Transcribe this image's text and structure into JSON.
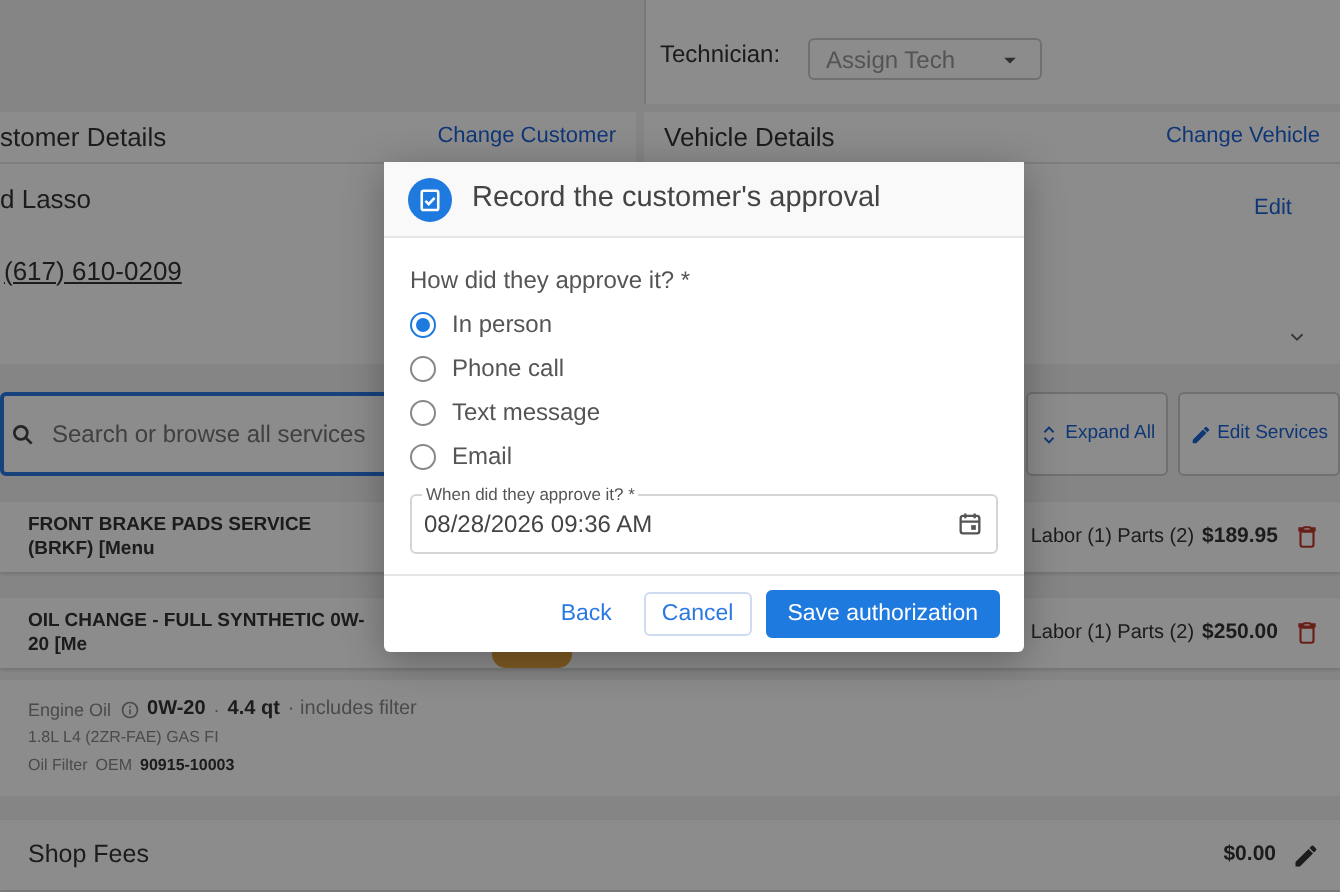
{
  "header_panel": {
    "technician_label": "Technician:",
    "technician_select": {
      "placeholder": "Assign Tech"
    }
  },
  "customer_card": {
    "title": "stomer Details",
    "action": "Change Customer",
    "name": "d Lasso",
    "phone": "(617) 610-0209"
  },
  "vehicle_card": {
    "title": "Vehicle Details",
    "action": "Change Vehicle",
    "edit": "Edit"
  },
  "services_toolbar": {
    "search": {
      "placeholder": "Search or browse all services"
    },
    "buttons": [
      {
        "label": "Expand All",
        "kind": "expand"
      },
      {
        "label": "Edit Services",
        "kind": "edit"
      }
    ]
  },
  "services": [
    {
      "kind": "service",
      "name": "FRONT BRAKE PADS SERVICE (BRKF) [Menu",
      "summary": "Labor (1) Parts (2)",
      "price": "$189.95"
    },
    {
      "kind": "service",
      "name": "OIL CHANGE - FULL SYNTHETIC 0W-20 [Me",
      "tagged": true,
      "summary": "Labor (1) Parts (2)",
      "price": "$250.00",
      "details": {
        "engine_oil_label": "Engine Oil",
        "viscosity": "0W-20",
        "separator": "·",
        "capacity": "4.4 qt",
        "note": "· includes filter",
        "engine": "1.8L L4 (2ZR-FAE) GAS FI",
        "filter_label": "Oil Filter",
        "filter_brand": "OEM",
        "filter_part": "90915-10003"
      }
    },
    {
      "kind": "fee",
      "name": "Shop Fees",
      "price": "$0.00"
    }
  ],
  "modal": {
    "title": "Record the customer's approval",
    "question": "How did they approve it? *",
    "options": [
      {
        "label": "In person",
        "selected": true
      },
      {
        "label": "Phone call",
        "selected": false
      },
      {
        "label": "Text message",
        "selected": false
      },
      {
        "label": "Email",
        "selected": false
      }
    ],
    "date_field": {
      "label": "When did they approve it? *",
      "value": "08/28/2026 09:36 AM"
    },
    "buttons": [
      {
        "label": "Back",
        "kind": "link"
      },
      {
        "label": "Cancel",
        "kind": "outline"
      },
      {
        "label": "Save authorization",
        "kind": "primary"
      }
    ]
  }
}
